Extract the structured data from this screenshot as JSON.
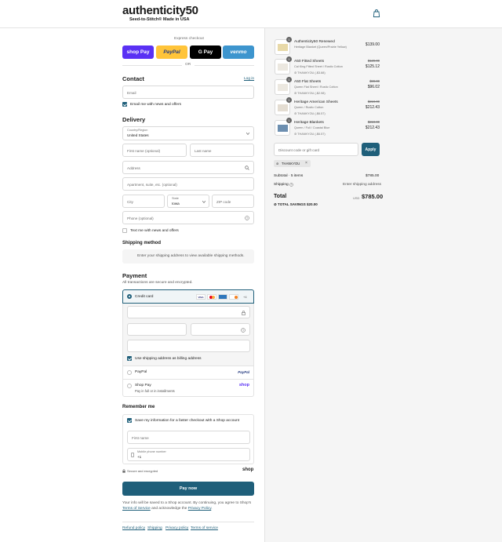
{
  "header": {
    "logo": "authenticity50",
    "tagline": "Seed-to-Stitch® Made in USA"
  },
  "express": {
    "title": "Express checkout",
    "or": "OR",
    "shop_pay": "shop Pay",
    "paypal": "PayPal",
    "gpay": "G Pay",
    "venmo": "venmo"
  },
  "contact": {
    "title": "Contact",
    "login": "Log in",
    "email_placeholder": "Email",
    "news_label": "Email me with news and offers"
  },
  "delivery": {
    "title": "Delivery",
    "country_label": "Country/Region",
    "country_value": "United States",
    "first_name": "First name (optional)",
    "last_name": "Last name",
    "address": "Address",
    "apartment": "Apartment, suite, etc. (optional)",
    "city": "City",
    "state_label": "State",
    "state_value": "Iowa",
    "zip": "ZIP code",
    "phone": "Phone (optional)",
    "text_label": "Text me with news and offers"
  },
  "shipping_method": {
    "title": "Shipping method",
    "message": "Enter your shipping address to view available shipping methods."
  },
  "payment": {
    "title": "Payment",
    "subtitle": "All transactions are secure and encrypted.",
    "credit_card": "Credit card",
    "card_more": "+4",
    "billing_label": "Use shipping address as billing address",
    "paypal": "PayPal",
    "paypal_logo": "PayPal",
    "shop_pay": "Shop Pay",
    "shop_pay_sub": "Pay in full or in installments",
    "shop_pay_logo": "shop"
  },
  "remember": {
    "title": "Remember me",
    "save_label": "Save my information for a faster checkout with a Shop account",
    "first_name": "First name",
    "mobile_label": "Mobile phone number",
    "mobile_value": "+1",
    "secure": "Secure and encrypted",
    "shop_logo": "shop"
  },
  "pay_now": "Pay now",
  "legal": {
    "line1": "Your info will be saved to a Shop account. By continuing, you agree to Shop's",
    "terms": "Terms of Service",
    "and": "and acknowledge the",
    "privacy": "Privacy Policy",
    "period": "."
  },
  "footer": {
    "refund": "Refund policy",
    "shipping": "Shipping",
    "privacy": "Privacy policy",
    "terms": "Terms of service"
  },
  "summary": {
    "items": [
      {
        "qty": "1",
        "name": "Authenticity50 Renewed",
        "variant": "Heritage Blanket (Queen/Prairie Yellow)",
        "discount": "",
        "orig": "",
        "price": "$139.00"
      },
      {
        "qty": "1",
        "name": "A50 Fitted Sheets",
        "variant": "Cal King Fitted Sheet / Rustic Cotton",
        "discount": "THANKYOU (-$3.88)",
        "orig": "$129.00",
        "price": "$125.12"
      },
      {
        "qty": "1",
        "name": "A50 Flat Sheets",
        "variant": "Queen Flat Sheet / Rustic Cotton",
        "discount": "THANKYOU (-$2.98)",
        "orig": "$99.00",
        "price": "$96.02"
      },
      {
        "qty": "1",
        "name": "Heritage American Sheets",
        "variant": "Queen / Rustic Cotton",
        "discount": "THANKYOU (-$6.57)",
        "orig": "$219.00",
        "price": "$212.43"
      },
      {
        "qty": "1",
        "name": "Heritage Blankets",
        "variant": "Queen / Full / Coastal Blue",
        "discount": "THANKYOU (-$6.57)",
        "orig": "$219.00",
        "price": "$212.43"
      }
    ],
    "discount_placeholder": "Discount code or gift card",
    "apply": "Apply",
    "code": "THANKYOU",
    "subtotal_label": "Subtotal · 5 items",
    "subtotal_value": "$785.00",
    "shipping_label": "Shipping",
    "shipping_value": "Enter shipping address",
    "total_label": "Total",
    "currency": "USD",
    "total_value": "$785.00",
    "savings_label": "TOTAL SAVINGS",
    "savings_value": "$20.00"
  },
  "colors": {
    "accent": "#1f5f7a",
    "shop_pay": "#5a31f4",
    "paypal": "#ffc439",
    "venmo": "#3d95ce"
  }
}
